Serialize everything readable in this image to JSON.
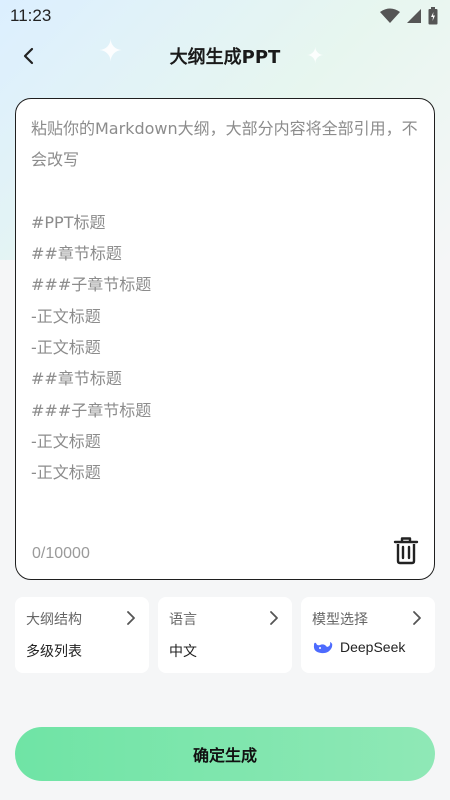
{
  "status_bar": {
    "time": "11:23"
  },
  "header": {
    "title": "大纲生成PPT"
  },
  "editor": {
    "placeholder": "粘贴你的Markdown大纲，大部分内容将全部引用，不会改写\n\n#PPT标题\n##章节标题\n###子章节标题\n-正文标题\n-正文标题\n##章节标题\n###子章节标题\n-正文标题\n-正文标题",
    "char_count": "0/10000"
  },
  "options": [
    {
      "label": "大纲结构",
      "value": "多级列表"
    },
    {
      "label": "语言",
      "value": "中文"
    },
    {
      "label": "模型选择",
      "value": "DeepSeek",
      "icon": "deepseek-whale-icon"
    }
  ],
  "generate_button": {
    "label": "确定生成"
  },
  "colors": {
    "accent_green": "#6fe4a5",
    "deepseek_blue": "#4d6bfe"
  }
}
